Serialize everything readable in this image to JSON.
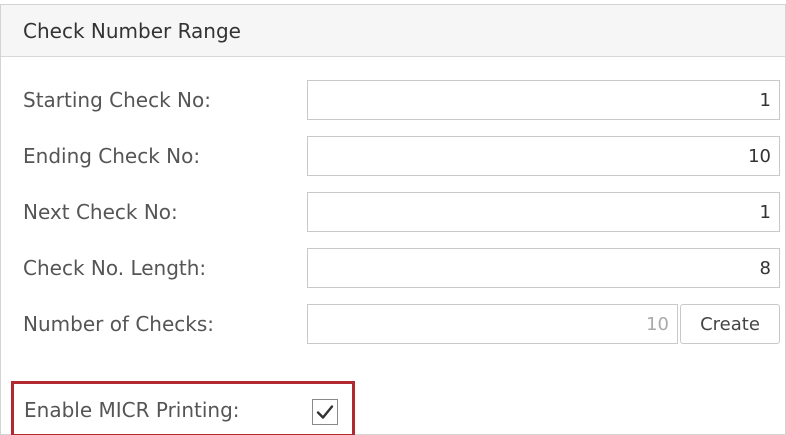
{
  "panel": {
    "title": "Check Number Range"
  },
  "fields": [
    {
      "label": "Starting Check No:",
      "value": "1"
    },
    {
      "label": "Ending Check No:",
      "value": "10"
    },
    {
      "label": "Next Check No:",
      "value": "1"
    },
    {
      "label": "Check No. Length:",
      "value": "8"
    },
    {
      "label": "Number of Checks:",
      "value": "10"
    }
  ],
  "create_button": {
    "label": "Create"
  },
  "micr": {
    "label": "Enable MICR Printing:",
    "checked": true,
    "highlight_color": "#b22a2f",
    "icon": "checkmark-icon"
  }
}
